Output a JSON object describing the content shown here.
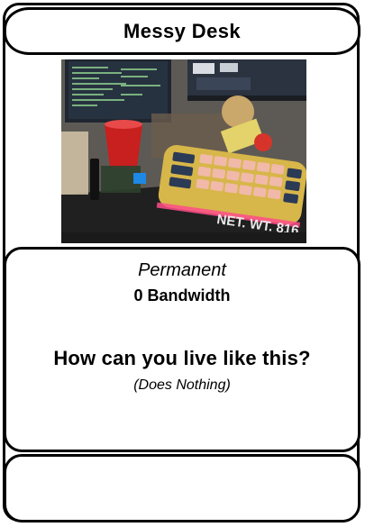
{
  "card": {
    "title": "Messy Desk",
    "type": "Permanent",
    "cost": "0 Bandwidth",
    "flavor": "How can you live like this?",
    "effect": "(Does Nothing)"
  },
  "art": {
    "mat_text": "NET. WT. 816"
  }
}
